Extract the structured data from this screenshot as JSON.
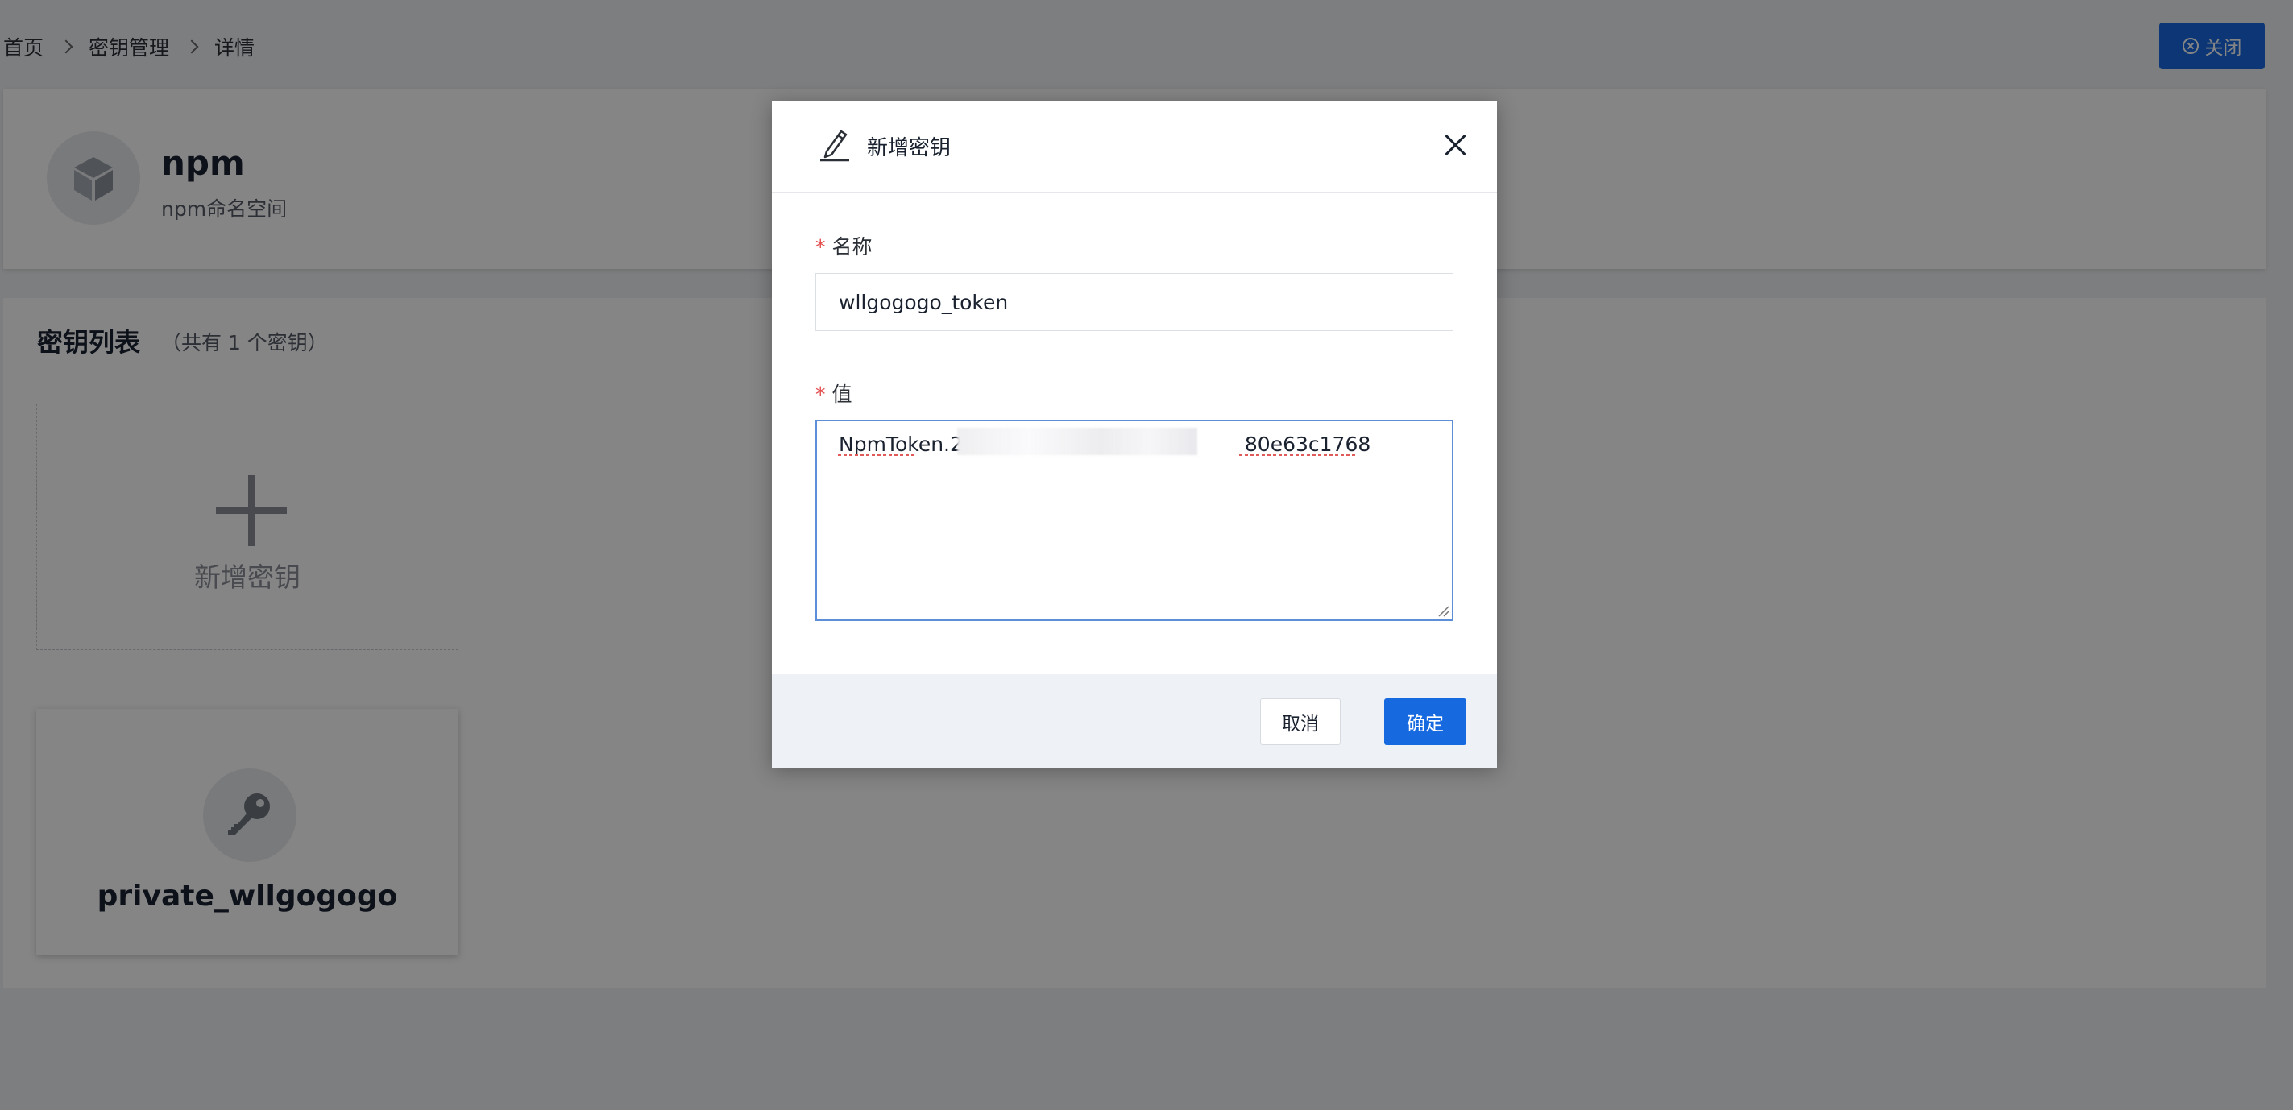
{
  "breadcrumb": {
    "home": "首页",
    "section": "密钥管理",
    "current": "详情"
  },
  "header": {
    "close_label": "关闭"
  },
  "namespace": {
    "name": "npm",
    "description": "npm命名空间",
    "icon": "cube-icon"
  },
  "secret_list": {
    "title": "密钥列表",
    "count_text": "（共有 1 个密钥）",
    "add_label": "新增密钥",
    "items": [
      {
        "name": "private_wllgogogo",
        "icon": "key-icon"
      }
    ]
  },
  "modal": {
    "title": "新增密钥",
    "icon": "edit-icon",
    "name_field": {
      "required_mark": "*",
      "label": "名称",
      "value": "wllgogogo_token"
    },
    "value_field": {
      "required_mark": "*",
      "label": "值",
      "value_visible_prefix": "NpmToken.2",
      "value_visible_suffix": "80e63c1768"
    },
    "cancel_label": "取消",
    "ok_label": "确定"
  },
  "colors": {
    "primary": "#1769e0",
    "required": "#e34d4d",
    "overlay": "rgba(0,0,0,0.48)"
  }
}
